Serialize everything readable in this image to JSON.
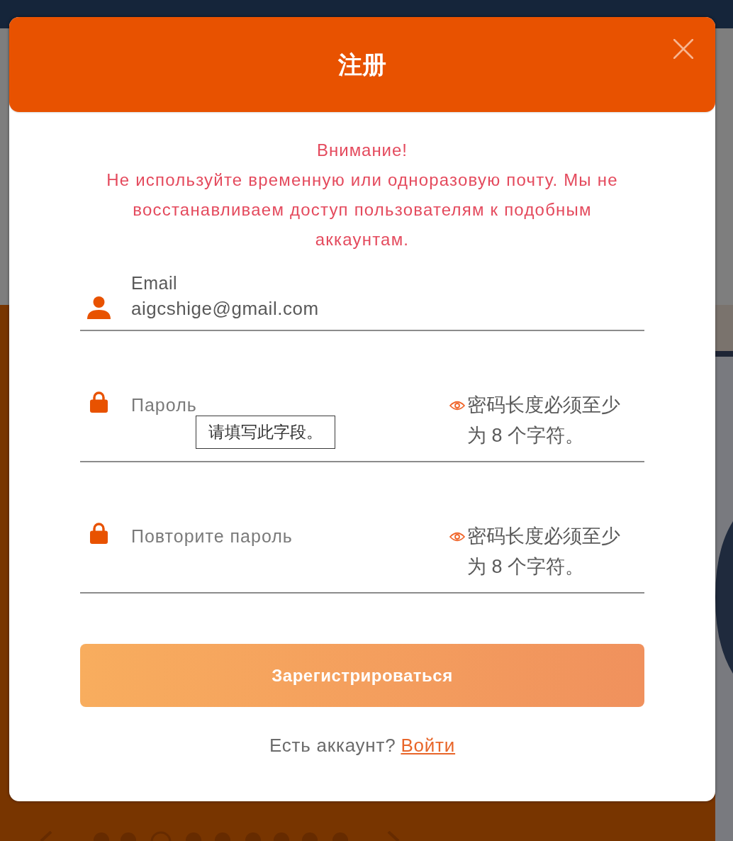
{
  "dialog": {
    "title": "注册"
  },
  "warning": {
    "heading": "Внимание!",
    "text": "Не используйте временную или одноразовую почту. Мы не восстанавливаем доступ пользователям к подобным аккаунтам."
  },
  "fields": [
    {
      "kind": "email",
      "label": "Email",
      "value": "aigcshige@gmail.com"
    },
    {
      "kind": "password",
      "placeholder": "Пароль",
      "hint": "密码长度必须至少为 8 个字符。",
      "tooltip": "请填写此字段。"
    },
    {
      "kind": "password",
      "placeholder": "Повторите пароль",
      "hint": "密码长度必须至少为 8 个字符。"
    }
  ],
  "submit": {
    "label": "Зарегистрироваться"
  },
  "footer": {
    "text": "Есть аккаунт?",
    "link": "Войти"
  }
}
